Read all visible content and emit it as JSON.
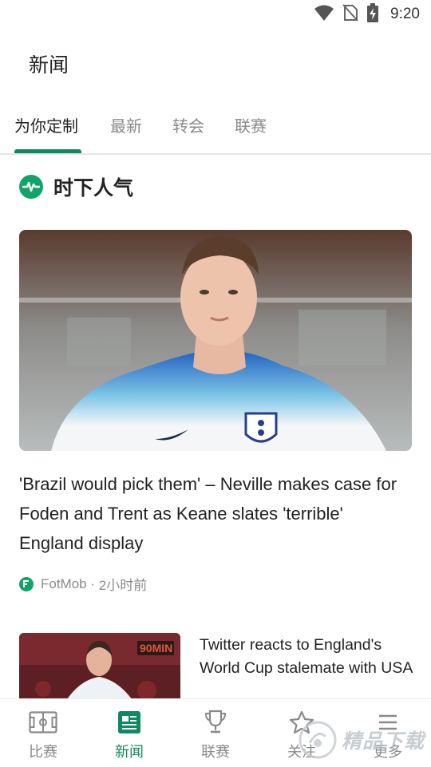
{
  "status_bar": {
    "time": "9:20",
    "icons": [
      "wifi-icon",
      "no-sim-icon",
      "battery-charging-icon"
    ]
  },
  "app_bar": {
    "title": "新闻"
  },
  "tabs": [
    {
      "label": "为你定制",
      "active": true
    },
    {
      "label": "最新",
      "active": false
    },
    {
      "label": "转会",
      "active": false
    },
    {
      "label": "联赛",
      "active": false
    }
  ],
  "section": {
    "title": "时下人气",
    "icon": "pulse-icon"
  },
  "articles": [
    {
      "title": "'Brazil would pick them' – Neville makes case for Foden and Trent as Keane slates 'terrible' England display",
      "source": "FotMob",
      "time_ago": "2小时前",
      "image": "england-player-photo"
    },
    {
      "title": "Twitter reacts to England's World Cup stalemate with USA",
      "image": "england-player-photo-90min",
      "image_badge": "90MIN"
    }
  ],
  "bottom_nav": [
    {
      "label": "比赛",
      "icon": "pitch-icon",
      "active": false
    },
    {
      "label": "新闻",
      "icon": "news-icon",
      "active": true
    },
    {
      "label": "联赛",
      "icon": "trophy-icon",
      "active": false
    },
    {
      "label": "关注",
      "icon": "star-icon",
      "active": false
    },
    {
      "label": "更多",
      "icon": "menu-icon",
      "active": false
    }
  ],
  "watermark": {
    "text": "精品下载"
  },
  "colors": {
    "accent": "#0f8a5f",
    "pulse_green": "#12a36a",
    "inactive": "#8a8a8a"
  }
}
